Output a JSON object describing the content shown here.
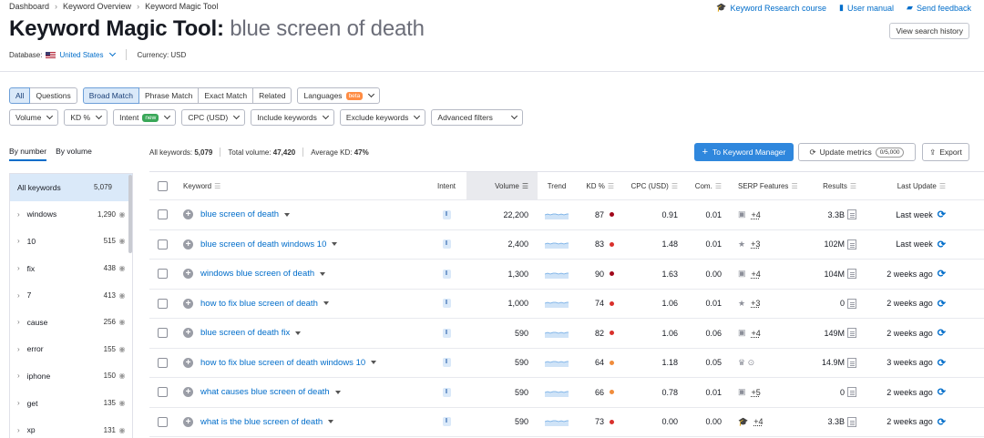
{
  "breadcrumbs": [
    "Dashboard",
    "Keyword Overview",
    "Keyword Magic Tool"
  ],
  "top_links": [
    "Keyword Research course",
    "User manual",
    "Send feedback"
  ],
  "title_prefix": "Keyword Magic Tool:",
  "title_query": "blue screen of death",
  "history_button": "View search history",
  "database_label": "Database:",
  "database_value": "United States",
  "currency_label": "Currency: USD",
  "filters_row1": {
    "match_tabs": [
      "All",
      "Questions"
    ],
    "match_types": [
      "Broad Match",
      "Phrase Match",
      "Exact Match",
      "Related"
    ],
    "languages": "Languages",
    "beta": "beta"
  },
  "filters_row2": {
    "volume": "Volume",
    "kd": "KD %",
    "intent": "Intent",
    "new": "new",
    "cpc": "CPC (USD)",
    "include": "Include keywords",
    "exclude": "Exclude keywords",
    "advanced": "Advanced filters"
  },
  "left_tabs": [
    "By number",
    "By volume"
  ],
  "groups": [
    {
      "name": "All keywords",
      "count": "5,079"
    },
    {
      "name": "windows",
      "count": "1,290"
    },
    {
      "name": "10",
      "count": "515"
    },
    {
      "name": "fix",
      "count": "438"
    },
    {
      "name": "7",
      "count": "413"
    },
    {
      "name": "cause",
      "count": "256"
    },
    {
      "name": "error",
      "count": "155"
    },
    {
      "name": "iphone",
      "count": "150"
    },
    {
      "name": "get",
      "count": "135"
    },
    {
      "name": "xp",
      "count": "131"
    }
  ],
  "stats": {
    "all_label": "All keywords:",
    "all_value": "5,079",
    "vol_label": "Total volume:",
    "vol_value": "47,420",
    "kd_label": "Average KD:",
    "kd_value": "47%"
  },
  "keyword_manager_button": "To Keyword Manager",
  "update_metrics_button": "Update metrics",
  "update_quota": "0/5,000",
  "export_button": "Export",
  "columns": [
    "Keyword",
    "Intent",
    "Volume",
    "Trend",
    "KD %",
    "CPC (USD)",
    "Com.",
    "SERP Features",
    "Results",
    "Last Update"
  ],
  "rows": [
    {
      "keyword": "blue screen of death",
      "intent": "I",
      "volume": "22,200",
      "kd": "87",
      "kd_color": "#a1071b",
      "cpc": "0.91",
      "com": "0.01",
      "serp_icon": "image-icon",
      "serp_more": "+4",
      "results": "3.3B",
      "updated": "Last week"
    },
    {
      "keyword": "blue screen of death windows 10",
      "intent": "I",
      "volume": "2,400",
      "kd": "83",
      "kd_color": "#d9302c",
      "cpc": "1.48",
      "com": "0.01",
      "serp_icon": "star-icon",
      "serp_more": "+3",
      "results": "102M",
      "updated": "Last week"
    },
    {
      "keyword": "windows blue screen of death",
      "intent": "I",
      "volume": "1,300",
      "kd": "90",
      "kd_color": "#a1071b",
      "cpc": "1.63",
      "com": "0.00",
      "serp_icon": "image-icon",
      "serp_more": "+4",
      "results": "104M",
      "updated": "2 weeks ago"
    },
    {
      "keyword": "how to fix blue screen of death",
      "intent": "I",
      "volume": "1,000",
      "kd": "74",
      "kd_color": "#d9302c",
      "cpc": "1.06",
      "com": "0.01",
      "serp_icon": "star-icon",
      "serp_more": "+3",
      "results": "0",
      "updated": "2 weeks ago"
    },
    {
      "keyword": "blue screen of death fix",
      "intent": "I",
      "volume": "590",
      "kd": "82",
      "kd_color": "#d9302c",
      "cpc": "1.06",
      "com": "0.06",
      "serp_icon": "image-icon",
      "serp_more": "+4",
      "results": "149M",
      "updated": "2 weeks ago"
    },
    {
      "keyword": "how to fix blue screen of death windows 10",
      "intent": "I",
      "volume": "590",
      "kd": "64",
      "kd_color": "#f08c3c",
      "cpc": "1.18",
      "com": "0.05",
      "serp_icon": "crown-icon",
      "serp_more": "",
      "results": "14.9M",
      "updated": "3 weeks ago"
    },
    {
      "keyword": "what causes blue screen of death",
      "intent": "I",
      "volume": "590",
      "kd": "66",
      "kd_color": "#f08c3c",
      "cpc": "0.78",
      "com": "0.01",
      "serp_icon": "image-icon",
      "serp_more": "+5",
      "results": "0",
      "updated": "2 weeks ago"
    },
    {
      "keyword": "what is the blue screen of death",
      "intent": "I",
      "volume": "590",
      "kd": "73",
      "kd_color": "#d9302c",
      "cpc": "0.00",
      "com": "0.00",
      "serp_icon": "cap-icon",
      "serp_more": "+4",
      "results": "3.3B",
      "updated": "2 weeks ago"
    }
  ]
}
